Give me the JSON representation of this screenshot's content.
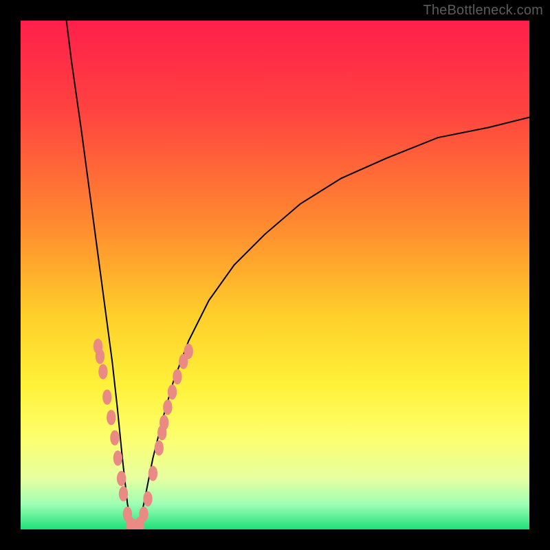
{
  "watermark": {
    "text": "TheBottleneck.com"
  },
  "colors": {
    "bg": "#000000",
    "curve": "#000000",
    "marker": "#e98a85",
    "gradient_stops": [
      {
        "pct": 0,
        "color": "#ff1f4b"
      },
      {
        "pct": 18,
        "color": "#ff4440"
      },
      {
        "pct": 40,
        "color": "#ff8a2f"
      },
      {
        "pct": 58,
        "color": "#ffcf2a"
      },
      {
        "pct": 72,
        "color": "#fff23a"
      },
      {
        "pct": 82,
        "color": "#fdff6e"
      },
      {
        "pct": 90,
        "color": "#e6ffa0"
      },
      {
        "pct": 95,
        "color": "#9fffb4"
      },
      {
        "pct": 100,
        "color": "#1fe07a"
      }
    ]
  },
  "chart_data": {
    "type": "line",
    "title": "",
    "xlabel": "",
    "ylabel": "",
    "xlim": [
      0,
      100
    ],
    "ylim": [
      0,
      100
    ],
    "notes": "V-shaped bottleneck curve; minimum reaches y≈0 near x≈22. Left branch is steep, right branch asymptotically rises toward ~80. Salmon markers cluster along both branches in the lower band (y≲35).",
    "series": [
      {
        "name": "bottleneck-curve",
        "x": [
          9,
          10,
          12,
          14,
          16,
          18,
          19,
          20,
          21,
          22,
          23,
          24,
          25,
          26,
          28,
          30,
          33,
          37,
          42,
          48,
          55,
          63,
          72,
          82,
          92,
          100
        ],
        "y": [
          100,
          92,
          78,
          63,
          48,
          33,
          24,
          14,
          5,
          0,
          0,
          4,
          9,
          14,
          22,
          29,
          37,
          45,
          52,
          58,
          64,
          69,
          73,
          77,
          79,
          81
        ]
      }
    ],
    "markers": {
      "name": "highlight-dots",
      "color": "#e98a85",
      "points": [
        {
          "x": 15.2,
          "y": 36
        },
        {
          "x": 15.6,
          "y": 34
        },
        {
          "x": 16.2,
          "y": 31
        },
        {
          "x": 17.0,
          "y": 26
        },
        {
          "x": 17.8,
          "y": 22
        },
        {
          "x": 18.5,
          "y": 18
        },
        {
          "x": 19.1,
          "y": 14
        },
        {
          "x": 19.8,
          "y": 10
        },
        {
          "x": 20.2,
          "y": 7
        },
        {
          "x": 21.0,
          "y": 3
        },
        {
          "x": 21.6,
          "y": 1
        },
        {
          "x": 22.4,
          "y": 0.5
        },
        {
          "x": 23.4,
          "y": 1
        },
        {
          "x": 24.2,
          "y": 3
        },
        {
          "x": 25.0,
          "y": 6
        },
        {
          "x": 26.0,
          "y": 11
        },
        {
          "x": 27.2,
          "y": 16
        },
        {
          "x": 27.8,
          "y": 19
        },
        {
          "x": 28.2,
          "y": 21
        },
        {
          "x": 28.9,
          "y": 24
        },
        {
          "x": 29.8,
          "y": 27
        },
        {
          "x": 30.8,
          "y": 30
        },
        {
          "x": 32.0,
          "y": 33
        },
        {
          "x": 33.0,
          "y": 35
        }
      ]
    }
  }
}
